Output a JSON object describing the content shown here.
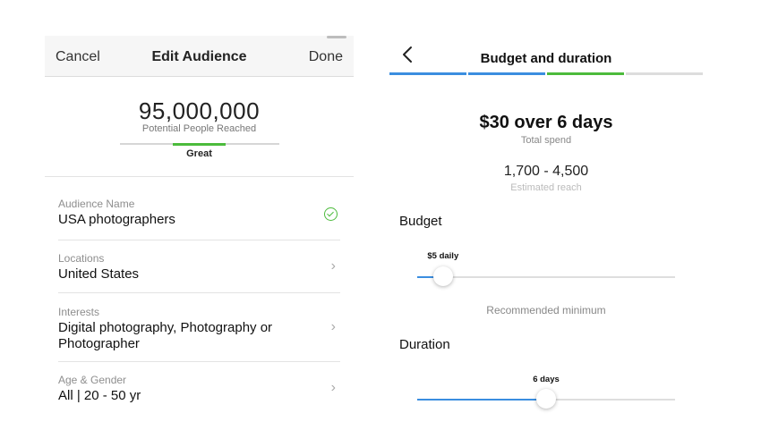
{
  "left": {
    "nav": {
      "cancel": "Cancel",
      "title": "Edit Audience",
      "done": "Done"
    },
    "reach": {
      "number": "95,000,000",
      "label": "Potential People Reached",
      "meter_label": "Great"
    },
    "rows": [
      {
        "label": "Audience Name",
        "value": "USA photographers",
        "indicator": "check-icon"
      },
      {
        "label": "Locations",
        "value": "United States",
        "indicator": "chevron-right-icon"
      },
      {
        "label": "Interests",
        "value_line1": "Digital photography, Photography or",
        "value_line2": "Photographer",
        "indicator": "chevron-right-icon"
      },
      {
        "label": "Age & Gender",
        "value": "All | 20 - 50 yr",
        "indicator": "chevron-right-icon"
      }
    ]
  },
  "right": {
    "header": {
      "title": "Budget and duration",
      "back_icon": "chevron-left-icon"
    },
    "progress_steps": [
      {
        "color": "#3b8ee0",
        "status": "complete"
      },
      {
        "color": "#3b8ee0",
        "status": "complete"
      },
      {
        "color": "#4cbb3c",
        "status": "current"
      },
      {
        "color": "#dddddd",
        "status": "pending"
      }
    ],
    "summary": {
      "spend": "$30 over 6 days",
      "spend_label": "Total spend",
      "reach": "1,700 - 4,500",
      "reach_label": "Estimated reach"
    },
    "budget": {
      "title": "Budget",
      "tip": "$5 daily",
      "fraction": 0.1,
      "note": "Recommended minimum"
    },
    "duration": {
      "title": "Duration",
      "tip": "6 days",
      "fraction": 0.5
    }
  },
  "colors": {
    "accent_blue": "#3b8ee0",
    "accent_green": "#4cbb3c"
  }
}
